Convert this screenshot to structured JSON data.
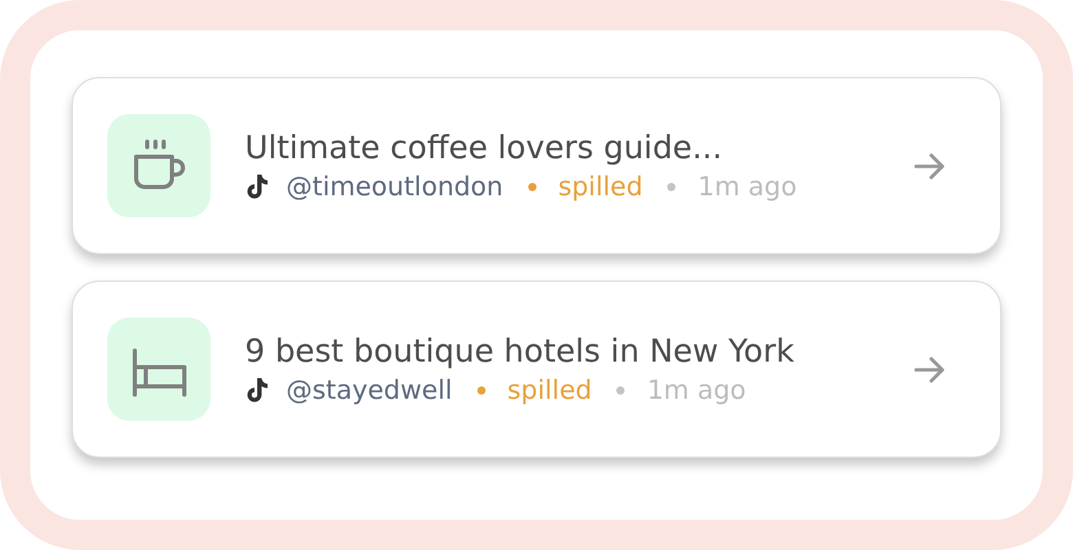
{
  "items": [
    {
      "kind": "coffee",
      "title": "Ultimate coffee lovers guide...",
      "handle": "@timeoutlondon",
      "status": "spilled",
      "time": "1m ago"
    },
    {
      "kind": "bed",
      "title": "9 best boutique hotels in New York",
      "handle": "@stayedwell",
      "status": "spilled",
      "time": "1m ago"
    }
  ]
}
